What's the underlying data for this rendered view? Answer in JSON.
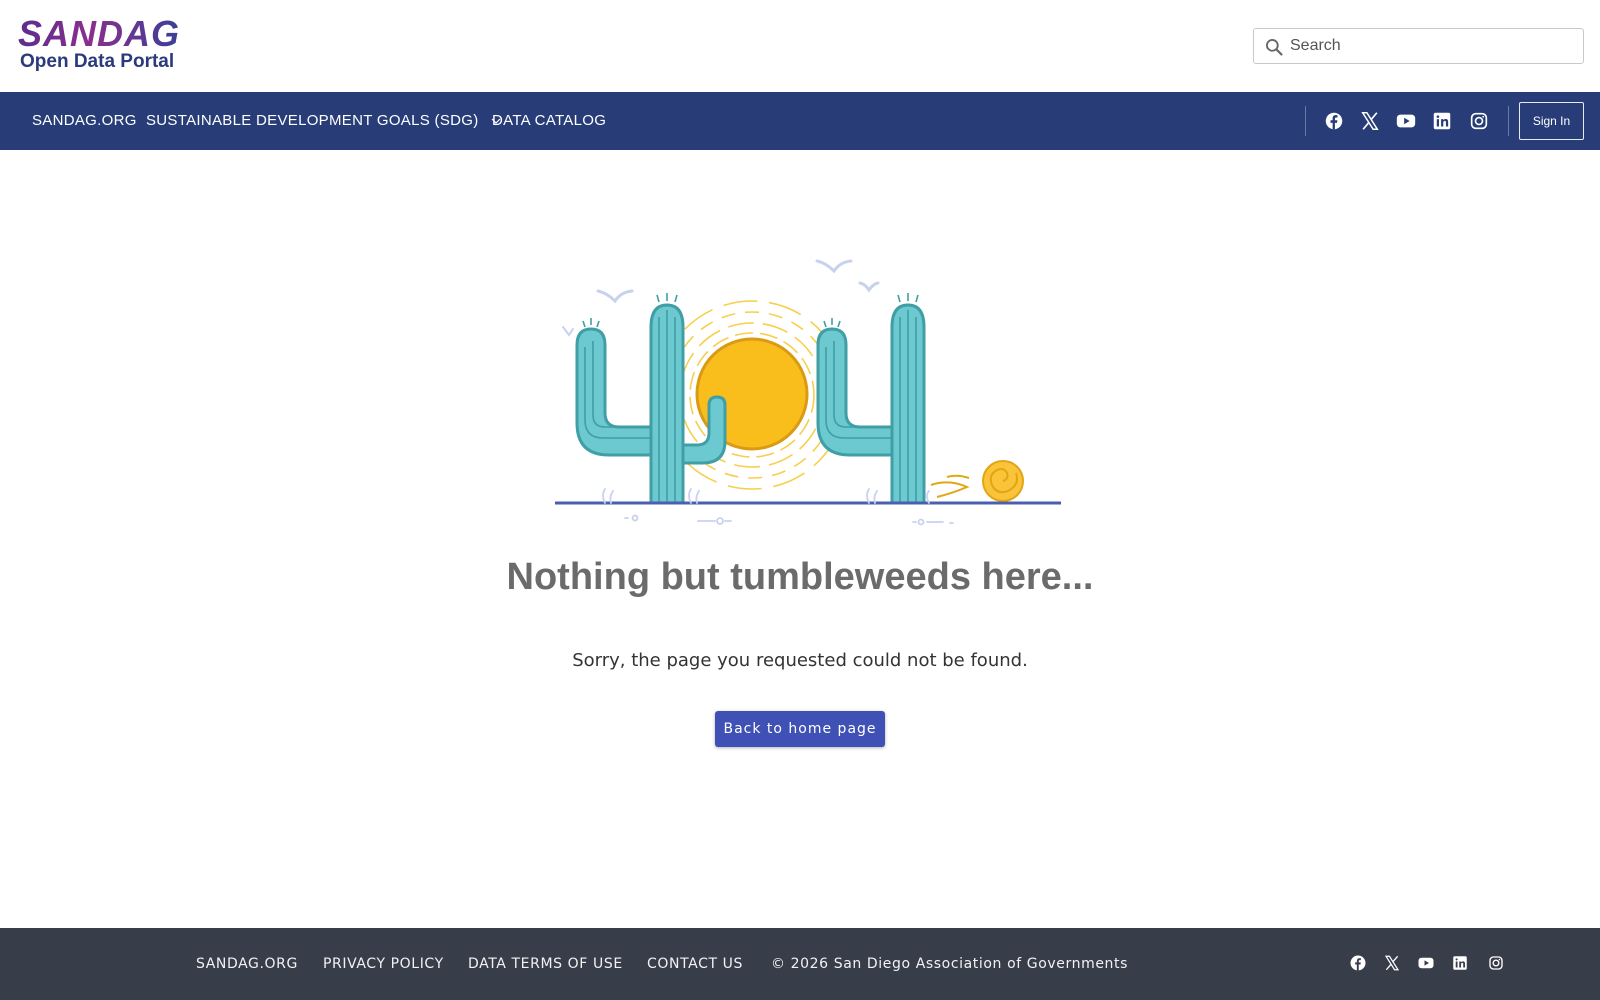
{
  "header": {
    "logo_text": "SANDAG",
    "logo_subtitle": "Open Data Portal",
    "search_placeholder": "Search"
  },
  "nav": {
    "items": [
      {
        "label": "SANDAG.ORG"
      },
      {
        "label": "SUSTAINABLE DEVELOPMENT GOALS (SDG)"
      },
      {
        "label": "DATA CATALOG"
      }
    ],
    "social": [
      "facebook-icon",
      "x-icon",
      "youtube-icon",
      "linkedin-icon",
      "instagram-icon"
    ],
    "signin_label": "Sign In"
  },
  "main": {
    "illustration": "404",
    "title": "Nothing but tumbleweeds here...",
    "subtitle": "Sorry, the page you requested could not be found.",
    "button_label": "Back to home page"
  },
  "footer": {
    "links": [
      {
        "label": "SANDAG.ORG"
      },
      {
        "label": "PRIVACY POLICY"
      },
      {
        "label": "DATA TERMS OF USE"
      },
      {
        "label": "CONTACT US"
      }
    ],
    "copyright": "© 2026 San Diego Association of Governments",
    "social": [
      "facebook-icon",
      "x-icon",
      "youtube-icon",
      "linkedin-icon",
      "instagram-icon"
    ]
  },
  "colors": {
    "navbar": "#283d78",
    "footer": "#383d4a",
    "button": "#3f51b5",
    "cactus": "#6cc9cf",
    "sun": "#f9bd1c"
  }
}
